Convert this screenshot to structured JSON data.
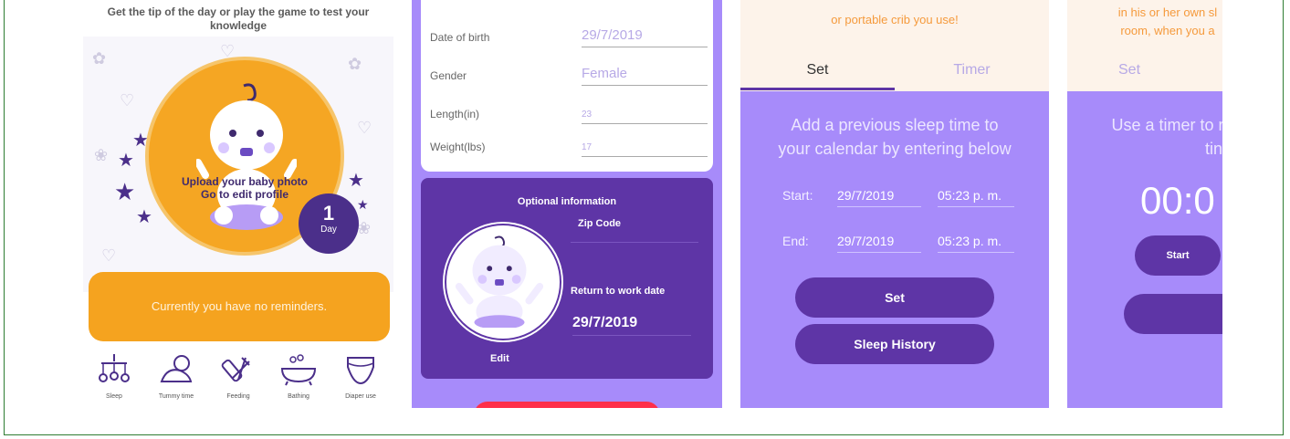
{
  "screen1": {
    "tip": "Get the tip of the day or play the game to test your knowledge",
    "upload_line1": "Upload your baby photo",
    "upload_line2": "Go to edit profile",
    "day_number": "1",
    "day_label": "Day",
    "reminder": "Currently you have no reminders.",
    "nav": [
      {
        "label": "Sleep",
        "icon": "mobile-icon"
      },
      {
        "label": "Tummy time",
        "icon": "baby-crawl-icon"
      },
      {
        "label": "Feeding",
        "icon": "bottle-icon"
      },
      {
        "label": "Bathing",
        "icon": "bathtub-icon"
      },
      {
        "label": "Diaper use",
        "icon": "diaper-icon"
      }
    ]
  },
  "screen2": {
    "fields": [
      {
        "label": "Date of birth",
        "value": "29/7/2019"
      },
      {
        "label": "Gender",
        "value": "Female"
      },
      {
        "label": "Length(in)",
        "value": "23"
      },
      {
        "label": "Weight(lbs)",
        "value": "17"
      }
    ],
    "optional_title": "Optional information",
    "zip_label": "Zip Code",
    "return_label": "Return to work date",
    "return_date": "29/7/2019",
    "edit_label": "Edit"
  },
  "screen3": {
    "top_message": "or portable crib you use!",
    "tab_set": "Set",
    "tab_timer": "Timer",
    "instruction_line1": "Add a previous sleep time to",
    "instruction_line2": "your calendar by entering below",
    "start_label": "Start:",
    "start_date": "29/7/2019",
    "start_time": "05:23 p. m.",
    "end_label": "End:",
    "end_date": "29/7/2019",
    "end_time": "05:23 p. m.",
    "set_button": "Set",
    "history_button": "Sleep History"
  },
  "screen4": {
    "top_line1": "in his or her own sl",
    "top_line2": "room, when you a",
    "tab_set": "Set",
    "instruction_line1": "Use a timer to r",
    "instruction_line2": "tin",
    "timer": "00:0",
    "start_button": "Start"
  },
  "colors": {
    "orange": "#f5a623",
    "purple_dark": "#5e35a6",
    "purple_light": "#a78bfa",
    "red": "#ff2f4a"
  }
}
